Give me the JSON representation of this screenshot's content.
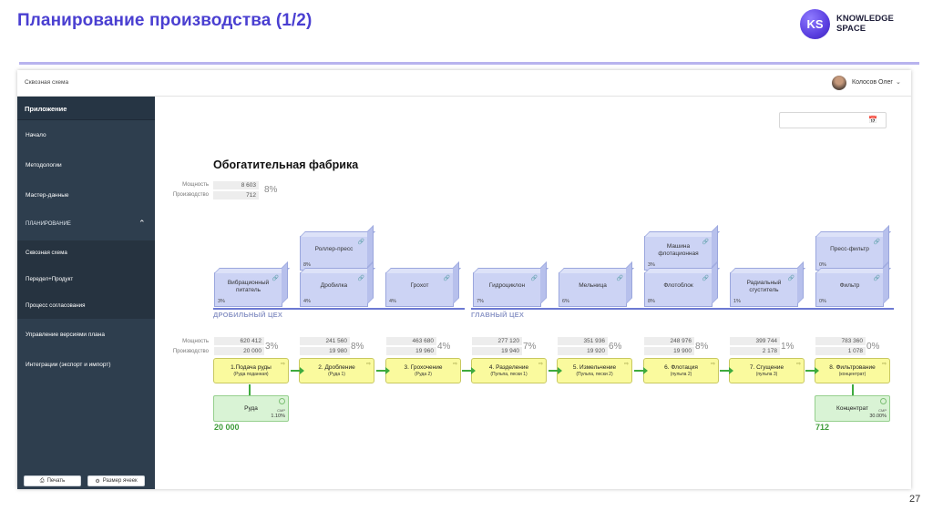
{
  "slide": {
    "title": "Планирование производства (1/2)",
    "logo_text": "KS",
    "brand": "KNOWLEDGE\nSPACE",
    "page_number": "27"
  },
  "app": {
    "title": "Сквозная схема",
    "user": {
      "name": "Колосов Олег",
      "avatar_icon": "user-avatar",
      "menu_icon": "chevron-down-icon"
    }
  },
  "sidebar": {
    "header": "Приложение",
    "items": [
      {
        "label": "Начало"
      },
      {
        "label": "Методологии"
      },
      {
        "label": "Мастер-данные"
      },
      {
        "label": "ПЛАНИРОВАНИЕ",
        "section": true,
        "expanded": true
      },
      {
        "label": "Сквозная схема",
        "active": true
      },
      {
        "label": "Передел+Продукт"
      },
      {
        "label": "Процесс согласования"
      },
      {
        "label": "Управление версиями плана"
      },
      {
        "label": "Интеграции (экспорт и импорт)"
      }
    ],
    "buttons": [
      {
        "label": "Печать",
        "icon": "printer-icon"
      },
      {
        "label": "Размер ячеек",
        "icon": "gear-icon"
      }
    ]
  },
  "main": {
    "date_icon": "calendar-icon",
    "factory": {
      "title": "Обогатительная фабрика",
      "capacity_label": "Мощность",
      "production_label": "Производство",
      "capacity": "8 603",
      "production": "712",
      "load_pct": "8%"
    },
    "shops": [
      {
        "label": "ДРОБИЛЬНЫЙ ЦЕХ"
      },
      {
        "label": "ГЛАВНЫЙ ЦЕХ"
      }
    ],
    "equipment": [
      {
        "name": "Вибрационный питатель",
        "pct": "3%"
      },
      {
        "name": "Роллер-пресс",
        "pct": "8%"
      },
      {
        "name": "Дробилка",
        "pct": "4%"
      },
      {
        "name": "Грохот",
        "pct": "4%"
      },
      {
        "name": "Гидроциклон",
        "pct": "7%"
      },
      {
        "name": "Мельница",
        "pct": "6%"
      },
      {
        "name": "Машина флотационная",
        "pct": "3%"
      },
      {
        "name": "Флотоблок",
        "pct": "8%"
      },
      {
        "name": "Радиальный сгуститель",
        "pct": "1%"
      },
      {
        "name": "Пресс-фильтр",
        "pct": "0%"
      },
      {
        "name": "Фильтр",
        "pct": "0%"
      }
    ],
    "process_labels": {
      "capacity": "Мощность",
      "production": "Производство"
    },
    "processes": [
      {
        "name": "1.Подача руды",
        "sub": "(Руда поданная)",
        "capacity": "620 412",
        "production": "20 000",
        "pct": "3%"
      },
      {
        "name": "2. Дробление",
        "sub": "(Руда 1)",
        "capacity": "241 560",
        "production": "19 980",
        "pct": "8%"
      },
      {
        "name": "3. Грохочение",
        "sub": "(Руда 2)",
        "capacity": "463 680",
        "production": "19 960",
        "pct": "4%"
      },
      {
        "name": "4. Разделение",
        "sub": "(Пульпа, пески 1)",
        "capacity": "277 120",
        "production": "19 940",
        "pct": "7%"
      },
      {
        "name": "5. Измельчение",
        "sub": "(Пульпа, пески 2)",
        "capacity": "351 936",
        "production": "19 920",
        "pct": "6%"
      },
      {
        "name": "6. Флотация",
        "sub": "(пульпа 2)",
        "capacity": "248 976",
        "production": "19 900",
        "pct": "8%"
      },
      {
        "name": "7. Сгущение",
        "sub": "(пульпа 3)",
        "capacity": "399 744",
        "production": "2 178",
        "pct": "1%"
      },
      {
        "name": "8. Фильтрование",
        "sub": "(концентрат)",
        "capacity": "783 360",
        "production": "1 078",
        "pct": "0%"
      }
    ],
    "materials": {
      "input": {
        "name": "Руда",
        "tag": "СМР",
        "pct": "1.10%",
        "total": "20 000"
      },
      "output": {
        "name": "Концентрат",
        "tag": "СМР",
        "pct": "30.00%",
        "total": "712"
      }
    }
  }
}
